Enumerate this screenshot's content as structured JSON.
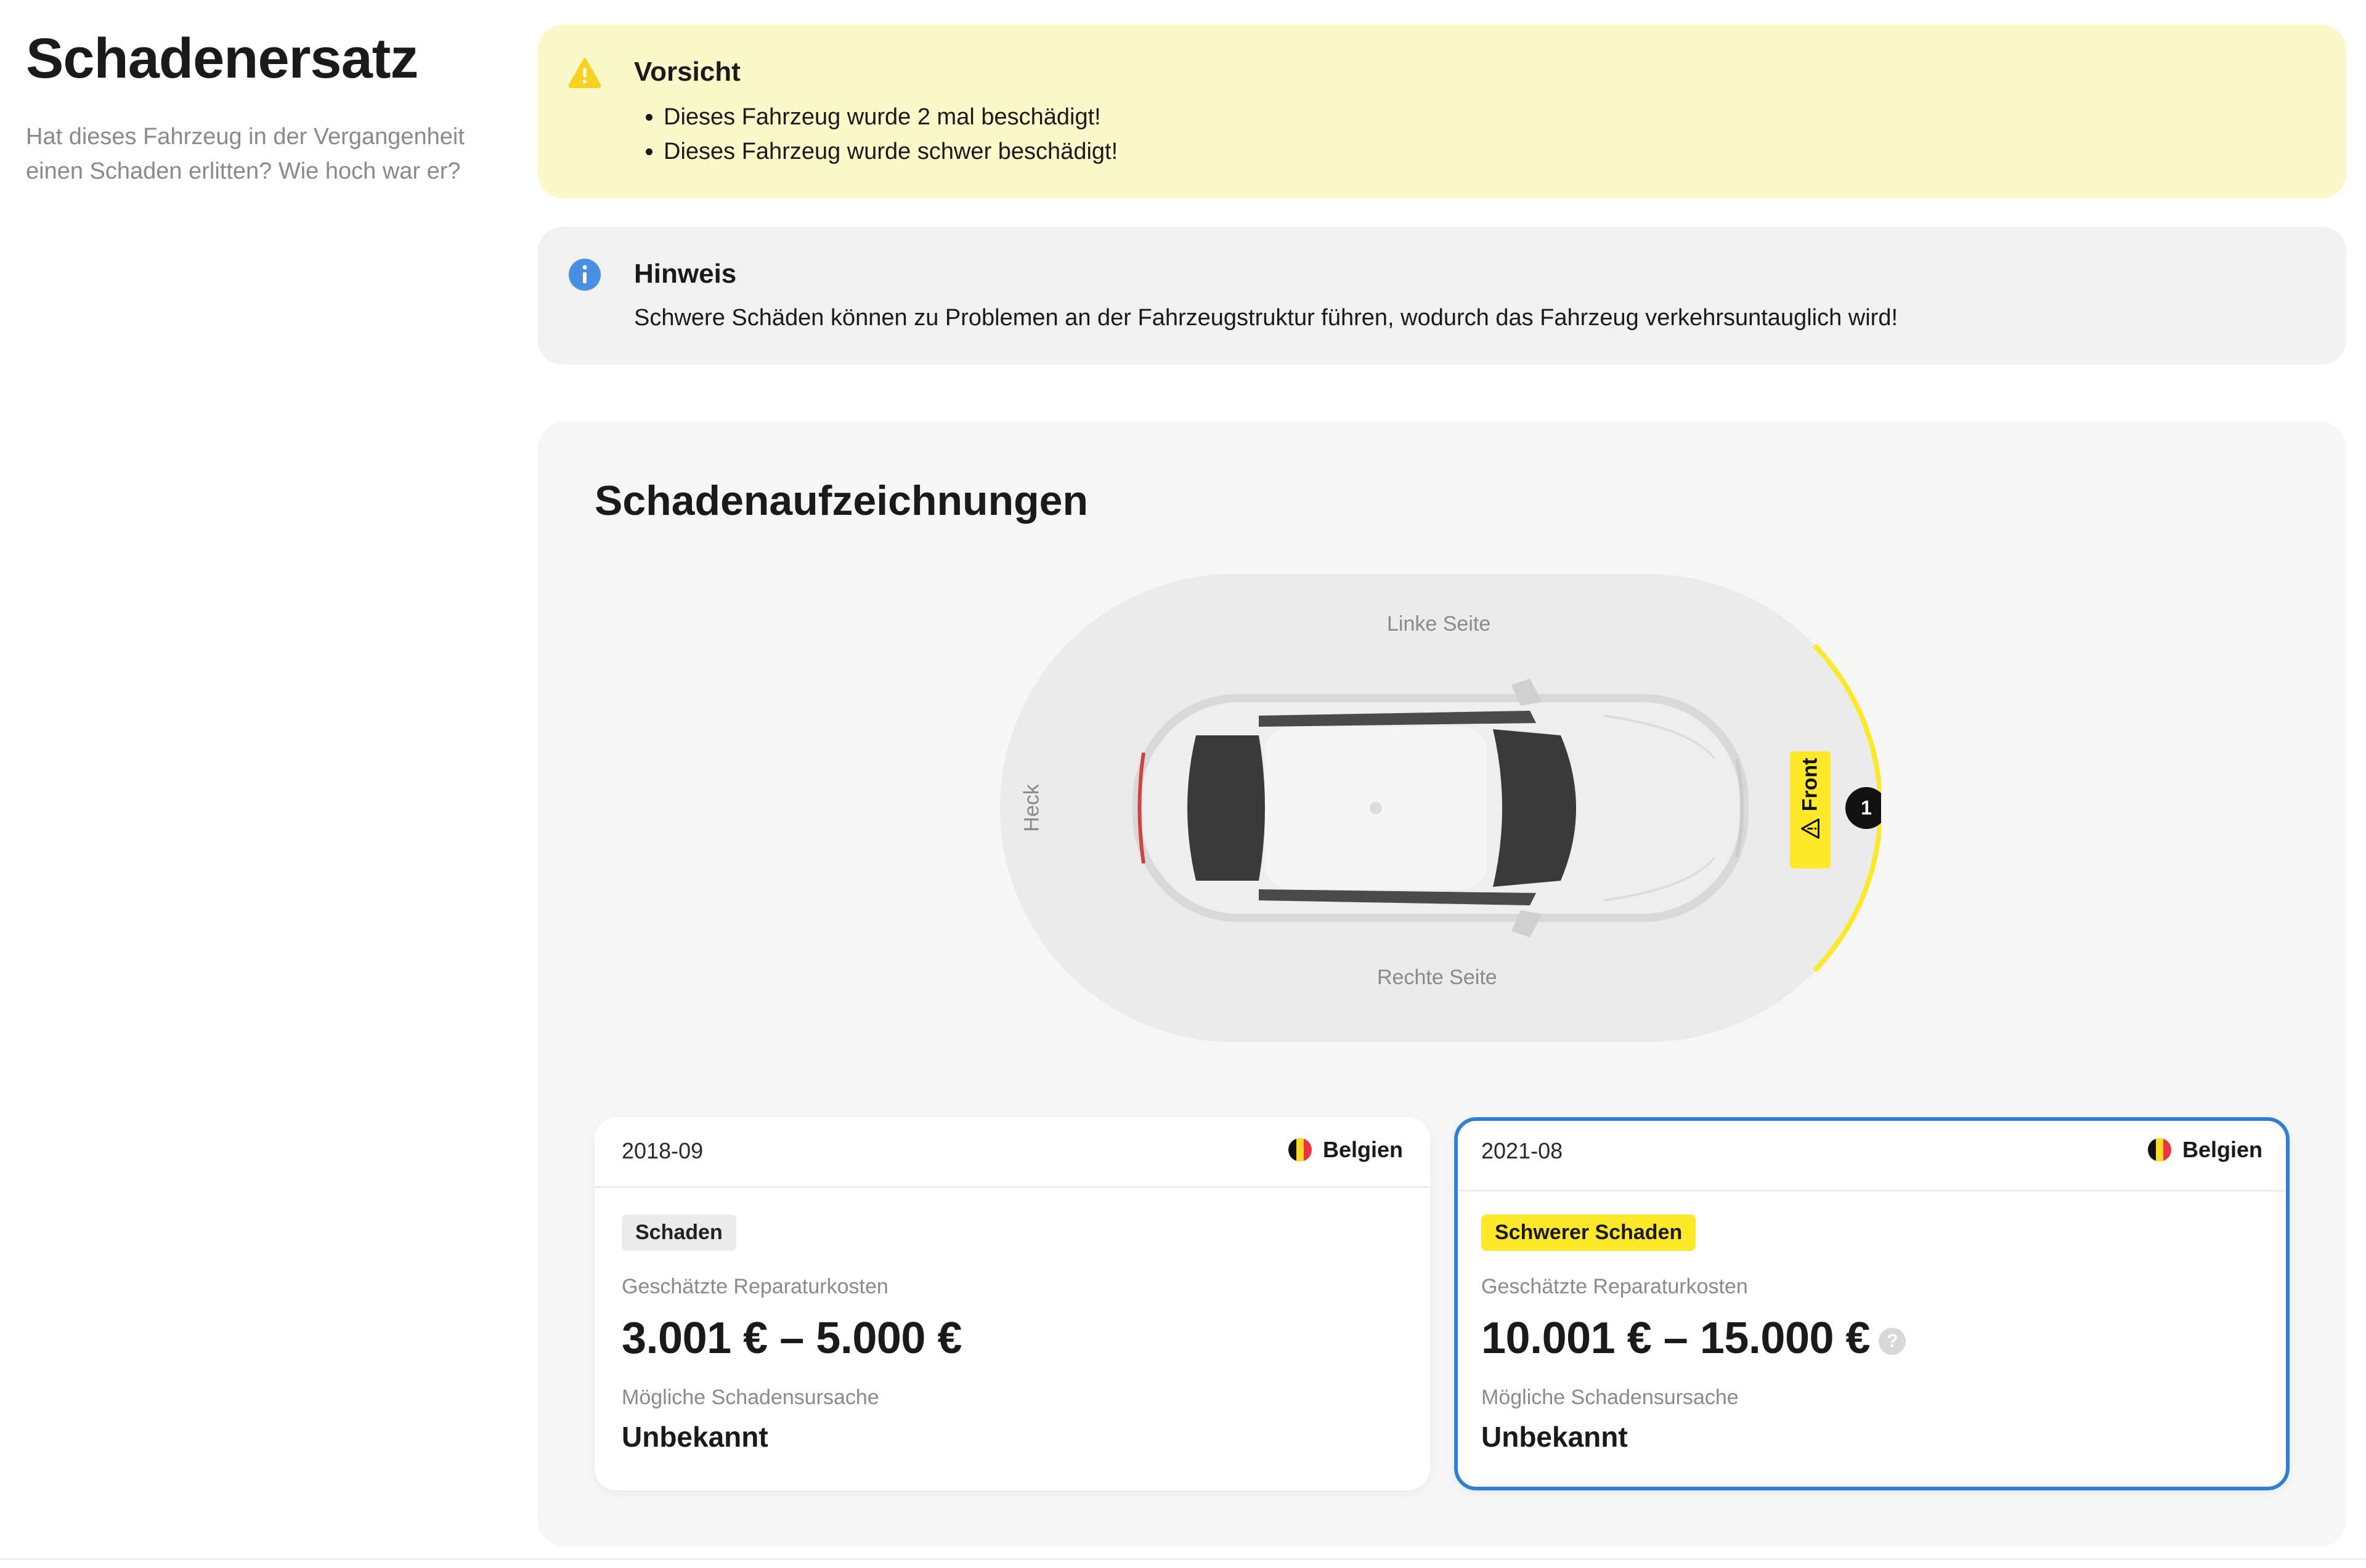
{
  "header": {
    "title": "Schadenersatz",
    "subtitle": "Hat dieses Fahrzeug in der Vergangenheit einen Schaden erlitten? Wie hoch war er?"
  },
  "warning": {
    "icon": "warning-icon",
    "title": "Vorsicht",
    "items": [
      "Dieses Fahrzeug wurde 2 mal beschädigt!",
      "Dieses Fahrzeug wurde schwer beschädigt!"
    ]
  },
  "info": {
    "icon": "info-icon",
    "title": "Hinweis",
    "body": "Schwere Schäden können zu Problemen an der Fahrzeugstruktur führen, wodurch das Fahrzeug verkehrsuntauglich wird!"
  },
  "records": {
    "title": "Schadenaufzeichnungen",
    "diagram": {
      "left_side": "Linke Seite",
      "right_side": "Rechte Seite",
      "rear": "Heck",
      "front": "Front",
      "front_count": "1",
      "highlight_color": "#fde82a"
    },
    "cards": [
      {
        "date": "2018-09",
        "country": "Belgien",
        "badge": "Schaden",
        "cost_label": "Geschätzte Reparaturkosten",
        "cost": "3.001 € – 5.000 €",
        "cause_label": "Mögliche Schadensursache",
        "cause": "Unbekannt"
      },
      {
        "date": "2021-08",
        "country": "Belgien",
        "badge": "Schwerer Schaden",
        "cost_label": "Geschätzte Reparaturkosten",
        "cost": "10.001 € – 15.000 €",
        "help": "?",
        "cause_label": "Mögliche Schadensursache",
        "cause": "Unbekannt"
      }
    ]
  },
  "colors": {
    "warning_bg": "#fdf8c9",
    "warning_icon": "#f7d21e",
    "info_bg": "#f1f1f1",
    "info_icon": "#4a90e2",
    "selected_border": "#2f7fd6",
    "severe_badge": "#fde82a"
  }
}
